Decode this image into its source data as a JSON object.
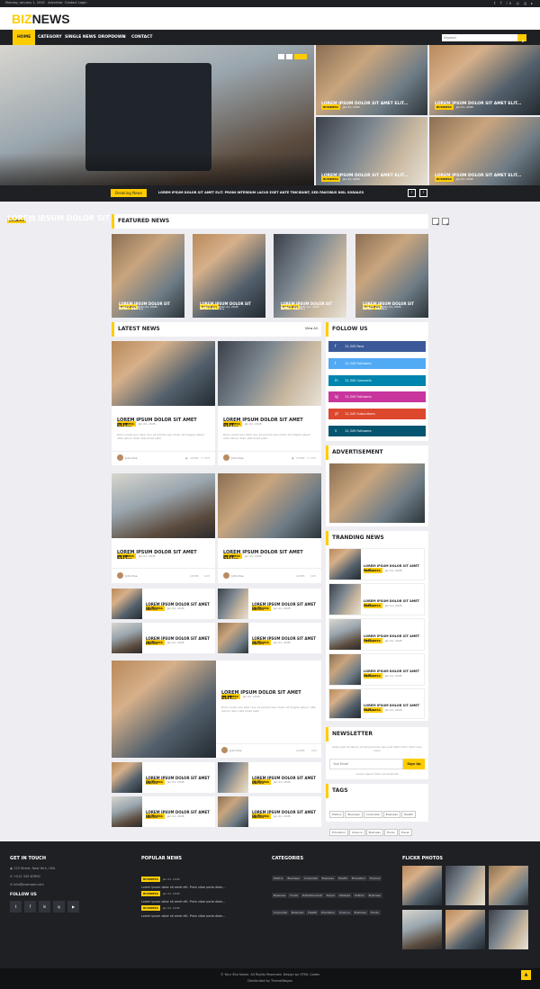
{
  "topbar": {
    "date": "Monday, January 1, 2045",
    "links": [
      "Advertise",
      "Contact",
      "Login"
    ],
    "social": [
      "twitter",
      "facebook",
      "linkedin",
      "instagram",
      "google",
      "youtube"
    ]
  },
  "logo": {
    "a": "BIZ",
    "b": "NEWS"
  },
  "nav": {
    "items": [
      "HOME",
      "CATEGORY",
      "SINGLE NEWS",
      "DROPDOWN",
      "CONTACT"
    ],
    "search_placeholder": "Keyword"
  },
  "hero": {
    "main": {
      "badge": "BUSINESS",
      "date": "Jan 01, 2045",
      "title": "LOREM IPSUM DOLOR SIT AMET ELIT. PROIN VITAE PORTA DIAM..."
    },
    "side": [
      {
        "badge": "BUSINESS",
        "date": "Jan 01, 2045",
        "title": "LOREM IPSUM DOLOR SIT AMET ELIT..."
      },
      {
        "badge": "BUSINESS",
        "date": "Jan 01, 2045",
        "title": "LOREM IPSUM DOLOR SIT AMET ELIT..."
      },
      {
        "badge": "BUSINESS",
        "date": "Jan 01, 2045",
        "title": "LOREM IPSUM DOLOR SIT AMET ELIT..."
      },
      {
        "badge": "BUSINESS",
        "date": "Jan 01, 2045",
        "title": "LOREM IPSUM DOLOR SIT AMET ELIT..."
      }
    ]
  },
  "breaking": {
    "label": "Breaking News",
    "text": "LOREM IPSUM DOLOR SIT AMET ELIT. PROIN INTERDUM LACUS EGET ANTE TINCIDUNT, SED FAUCIBUS NISL SODALES"
  },
  "featured": {
    "heading": "FEATURED NEWS",
    "items": [
      {
        "badge": "BUSINESS",
        "date": "Jan 01, 2045",
        "title": "LOREM IPSUM DOLOR SIT AMET ELIT..."
      },
      {
        "badge": "BUSINESS",
        "date": "Jan 01, 2045",
        "title": "LOREM IPSUM DOLOR SIT AMET ELIT..."
      },
      {
        "badge": "BUSINESS",
        "date": "Jan 01, 2045",
        "title": "LOREM IPSUM DOLOR SIT AMET ELIT..."
      },
      {
        "badge": "BUSINESS",
        "date": "Jan 01, 2045",
        "title": "LOREM IPSUM DOLOR SIT AMET ELIT..."
      }
    ]
  },
  "latest": {
    "heading": "LATEST NEWS",
    "view_all": "View All",
    "badge": "BUSINESS",
    "date": "Jan 01, 2045",
    "title": "LOREM IPSUM DOLOR SIT AMET ELIT...",
    "excerpt": "Dolor lorem eos dolor duo et eirmod sea. Dolor sit magna rebum clita rebum dolor stet amet justo",
    "author": "John Doe",
    "views": "12345",
    "comments": "123"
  },
  "follow": {
    "heading": "FOLLOW US",
    "items": [
      {
        "icon": "f",
        "text": "12,345 Fans",
        "color": "#3b5998"
      },
      {
        "icon": "t",
        "text": "12,345 Followers",
        "color": "#52aaf4"
      },
      {
        "icon": "in",
        "text": "12,345 Connects",
        "color": "#0185ae"
      },
      {
        "icon": "ig",
        "text": "12,345 Followers",
        "color": "#c8359d"
      },
      {
        "icon": "yt",
        "text": "12,345 Subscribers",
        "color": "#dc472e"
      },
      {
        "icon": "v",
        "text": "12,345 Followers",
        "color": "#055570"
      }
    ]
  },
  "ad": {
    "heading": "ADVERTISEMENT"
  },
  "trending": {
    "heading": "TRANDING NEWS"
  },
  "newsletter": {
    "heading": "NEWSLETTER",
    "text": "Aliqu justo et labore at eirmod justo sea erat diam dolor diam vero kasd",
    "placeholder": "Your Email",
    "button": "Sign Up",
    "note": "Lorem ipsum dolor sit amet elit"
  },
  "tags": {
    "heading": "TAGS",
    "items": [
      "Politics",
      "Business",
      "Corporate",
      "Business",
      "Health",
      "Education",
      "Science",
      "Business",
      "Foods",
      "Travel"
    ]
  },
  "footer": {
    "contact_heading": "GET IN TOUCH",
    "address": "123 Street, New York, USA",
    "phone": "+012 345 67890",
    "email": "info@example.com",
    "follow_heading": "FOLLOW US",
    "popular_heading": "POPULAR NEWS",
    "popular": [
      {
        "badge": "BUSINESS",
        "date": "Jan 01, 2045",
        "text": "Lorem ipsum dolor sit amet elit. Proin vitae porta diam..."
      },
      {
        "badge": "BUSINESS",
        "date": "Jan 01, 2045",
        "text": "Lorem ipsum dolor sit amet elit. Proin vitae porta diam..."
      },
      {
        "badge": "BUSINESS",
        "date": "Jan 01, 2045",
        "text": "Lorem ipsum dolor sit amet elit. Proin vitae porta diam..."
      }
    ],
    "categories_heading": "CATEGORIES",
    "categories": [
      "Politics",
      "Business",
      "Corporate",
      "Business",
      "Health",
      "Education",
      "Science",
      "Business",
      "Foods",
      "Entertainment",
      "Travel",
      "Lifestyle",
      "Politics",
      "Business",
      "Corporate",
      "Business",
      "Health",
      "Education",
      "Science",
      "Business",
      "Foods"
    ],
    "flickr_heading": "FLICKR PHOTOS"
  },
  "copyright": {
    "line1": "© Your Site Name. All Rights Reserved. Design by HTML Codex",
    "line2": "Distributed by ThemeWagon"
  },
  "colors": {
    "accent": "#ffcc00",
    "dark": "#1e2024"
  }
}
